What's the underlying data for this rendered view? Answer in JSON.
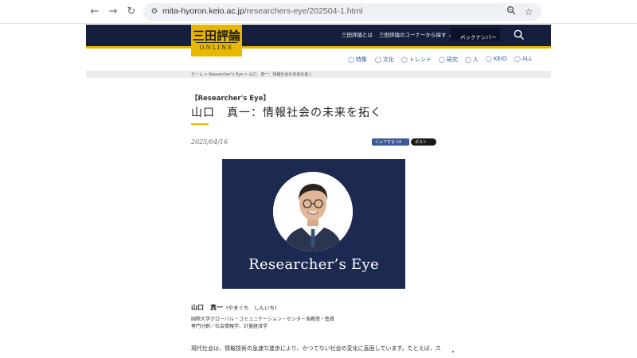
{
  "browser": {
    "url_host": "mita-hyoron.keio.ac.jp",
    "url_path": "/researchers-eye/202504-1.html"
  },
  "site": {
    "logo_jp": "三田評論",
    "logo_en": "ONLINE",
    "nav": {
      "about": "三田評論とは",
      "corners": "三田評論のコーナーから探す",
      "backnumber": "バックナンバー"
    },
    "categories": [
      "特集",
      "文化",
      "トレンド",
      "研究",
      "人",
      "KEIO",
      "ALL"
    ]
  },
  "breadcrumb": "ホーム > Researcher's Eye > 山口　真一：情報社会の未来を拓く",
  "article": {
    "kicker": "【Researcher's Eye】",
    "title": "山口　真一：情報社会の未来を拓く",
    "date": "2025/04/16",
    "share_fb": "シェアする 14",
    "share_x": "ポスト",
    "hero_caption": "Researcher’s Eye",
    "author_name": "山口　真一",
    "author_reading": "(やまぐち　しんいち)",
    "affiliation": "国際大学グローバル・コミュニケーション・センター准教授・塾員",
    "field": "専門分野／社会情報学、計量経済学",
    "body_first_line": "現代社会は、情報技術の急速な進歩により、かつてない社会の変化に直面しています。たとえば、ス"
  },
  "colors": {
    "navy": "#151e3d",
    "gold": "#e6b900",
    "link_blue": "#2a56a8"
  }
}
